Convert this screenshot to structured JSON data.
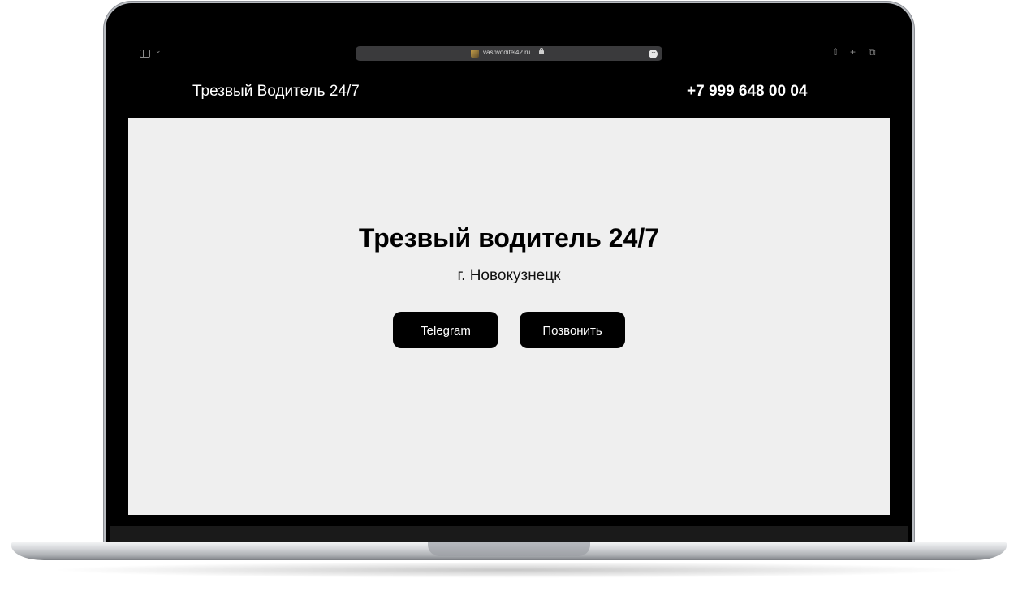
{
  "browser": {
    "url": "vashvoditel42.ru",
    "icons": [
      "sidebar-icon",
      "chevron-down-icon",
      "favicon",
      "lock-icon",
      "more-icon",
      "share-icon",
      "plus-icon",
      "tabs-icon"
    ]
  },
  "header": {
    "brand": "Трезвый Водитель 24/7",
    "phone": "+7 999 648 00 04"
  },
  "hero": {
    "title": "Трезвый водитель 24/7",
    "city": "г. Новокузнецк",
    "buttons": [
      {
        "label": "Telegram"
      },
      {
        "label": "Позвонить"
      }
    ]
  },
  "colors": {
    "bezel": "#000000",
    "page_background": "#efefef",
    "button_background": "#000000",
    "button_text": "#ffffff"
  }
}
